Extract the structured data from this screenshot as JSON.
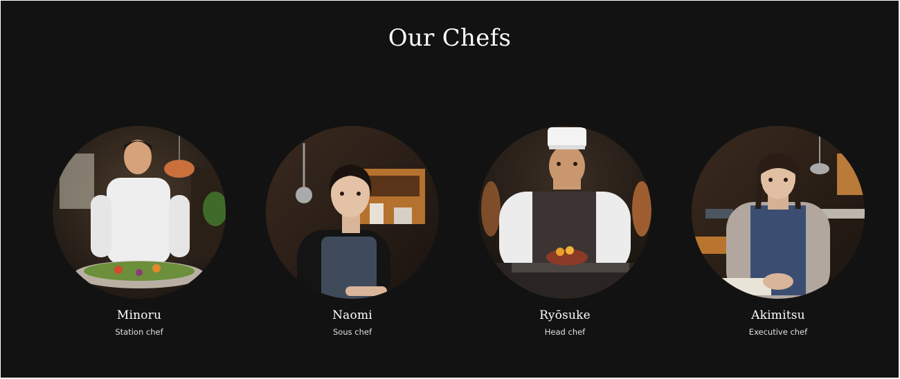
{
  "section": {
    "title": "Our Chefs"
  },
  "chefs": [
    {
      "name": "Minoru",
      "role": "Station chef",
      "photo": "chef-photo-minoru"
    },
    {
      "name": "Naomi",
      "role": "Sous chef",
      "photo": "chef-photo-naomi"
    },
    {
      "name": "Ryōsuke",
      "role": "Head chef",
      "photo": "chef-photo-ryosuke"
    },
    {
      "name": "Akimitsu",
      "role": "Executive chef",
      "photo": "chef-photo-akimitsu"
    }
  ],
  "colors": {
    "background": "#121212",
    "text": "#ffffff",
    "subtext": "#e0e0e0"
  }
}
